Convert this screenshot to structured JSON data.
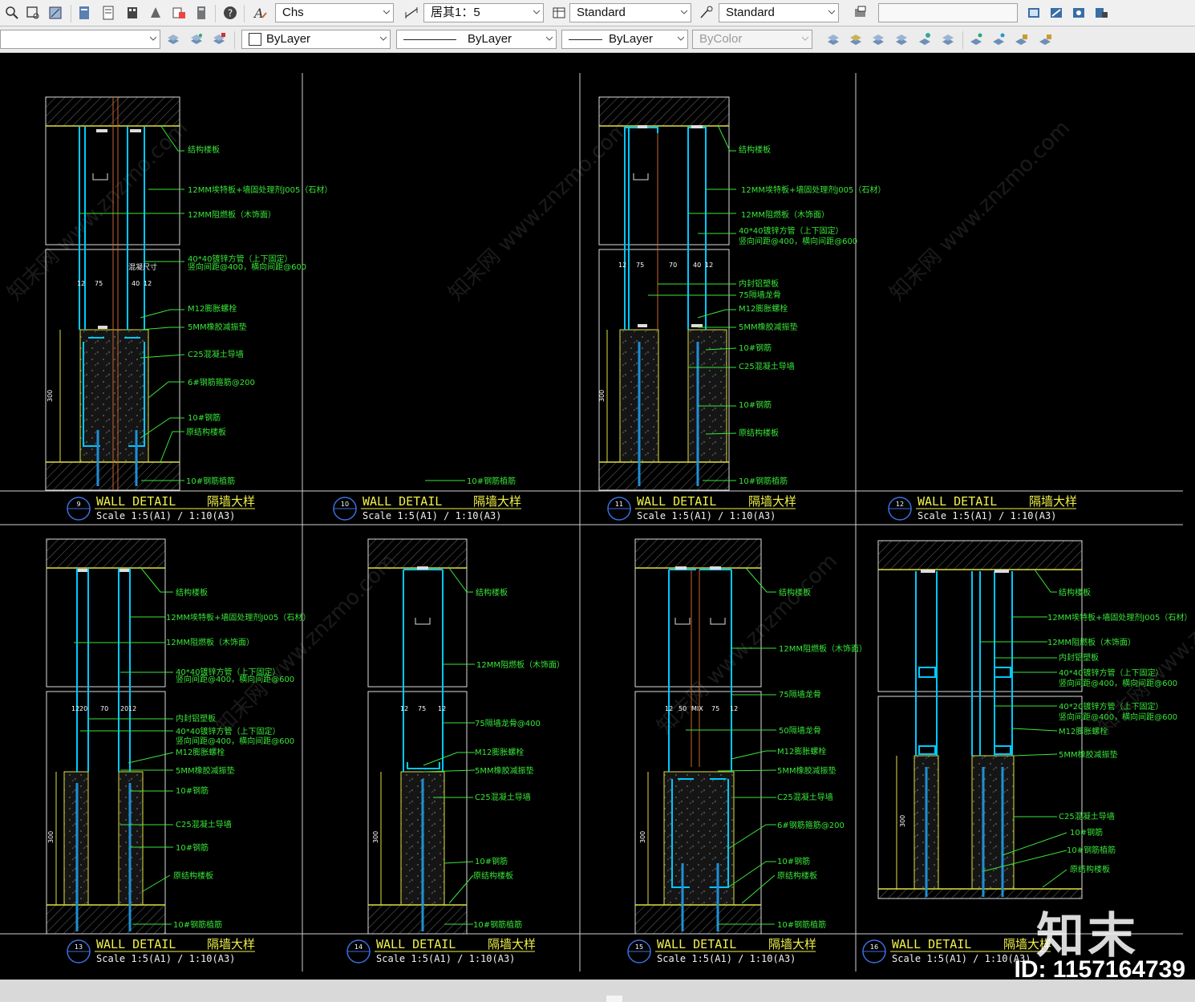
{
  "toolbar1": {
    "text_style": "Chs",
    "dim_scale": "居其1：5",
    "table_style": "Standard",
    "multileader_style": "Standard",
    "search_value": ""
  },
  "toolbar2": {
    "layer": "",
    "color": "ByLayer",
    "linetype": "ByLayer",
    "lineweight": "ByLayer",
    "plotstyle": "ByColor"
  },
  "watermark": {
    "text": "知末网 www.znzmo.com"
  },
  "logo": {
    "text": "知末",
    "id": "ID: 1157164739"
  },
  "details": [
    {
      "num": "9",
      "title": "WALL DETAIL",
      "cn": "隔墙大样",
      "scale": "Scale 1:5(A1) / 1:10(A3)"
    },
    {
      "num": "10",
      "title": "WALL DETAIL",
      "cn": "隔墙大样",
      "scale": "Scale 1:5(A1) / 1:10(A3)"
    },
    {
      "num": "11",
      "title": "WALL DETAIL",
      "cn": "隔墙大样",
      "scale": "Scale 1:5(A1) / 1:10(A3)"
    },
    {
      "num": "12",
      "title": "WALL DETAIL",
      "cn": "隔墙大样",
      "scale": "Scale 1:5(A1) / 1:10(A3)"
    },
    {
      "num": "13",
      "title": "WALL DETAIL",
      "cn": "隔墙大样",
      "scale": "Scale 1:5(A1) / 1:10(A3)"
    },
    {
      "num": "14",
      "title": "WALL DETAIL",
      "cn": "隔墙大样",
      "scale": "Scale 1:5(A1) / 1:10(A3)"
    },
    {
      "num": "15",
      "title": "WALL DETAIL",
      "cn": "隔墙大样",
      "scale": "Scale 1:5(A1) / 1:10(A3)"
    },
    {
      "num": "16",
      "title": "WALL DETAIL",
      "cn": "隔墙大样",
      "scale": "Scale 1:5(A1) / 1:10(A3)"
    }
  ],
  "labels": {
    "d9": [
      "结构楼板",
      "12MM埃特板+墙固处理剂J005（石材）",
      "12MM阻燃板（木饰面）",
      "40*40镀锌方管（上下固定）",
      "竖向间距@400，横向间距@600",
      "M12膨胀螺栓",
      "5MM橡胶减振垫",
      "C25混凝土导墙",
      "6#钢筋箍筋@200",
      "10#钢筋",
      "原结构楼板",
      "10#钢筋植筋"
    ],
    "d9_dims": [
      "12",
      "75",
      "40",
      "12",
      "300",
      "混凝尺寸"
    ],
    "d10": [
      "10#钢筋植筋"
    ],
    "d11": [
      "结构楼板",
      "12MM埃特板+墙固处理剂J005（石材）",
      "12MM阻燃板（木饰面）",
      "40*40镀锌方管（上下固定）",
      "竖向间距@400，横向间距@600",
      "内封铝塑板",
      "75隔墙龙骨",
      "M12膨胀螺栓",
      "5MM橡胶减振垫",
      "10#钢筋",
      "C25混凝土导墙",
      "10#钢筋",
      "原结构楼板",
      "10#钢筋植筋"
    ],
    "d11_dims": [
      "12",
      "75",
      "70",
      "40",
      "12",
      "300"
    ],
    "d13": [
      "结构楼板",
      "12MM埃特板+墙固处理剂J005（石材）",
      "12MM阻燃板（木饰面）",
      "40*40镀锌方管（上下固定）",
      "竖向间距@400，横向间距@600",
      "内封铝塑板",
      "40*40镀锌方管（上下固定）",
      "竖向间距@400，横向间距@600",
      "M12膨胀螺栓",
      "5MM橡胶减振垫",
      "10#钢筋",
      "C25混凝土导墙",
      "10#钢筋",
      "原结构楼板",
      "10#钢筋植筋"
    ],
    "d13_dims": [
      "12",
      "20",
      "70",
      "20",
      "12",
      "300"
    ],
    "d14": [
      "结构楼板",
      "12MM阻燃板（木饰面）",
      "75隔墙龙骨@400",
      "M12膨胀螺栓",
      "5MM橡胶减振垫",
      "C25混凝土导墙",
      "10#钢筋",
      "原结构楼板",
      "10#钢筋植筋"
    ],
    "d14_dims": [
      "12",
      "75",
      "12",
      "300"
    ],
    "d15": [
      "结构楼板",
      "12MM阻燃板（木饰面）",
      "75隔墙龙骨",
      "50隔墙龙骨",
      "M12膨胀螺栓",
      "5MM橡胶减振垫",
      "C25混凝土导墙",
      "6#钢筋箍筋@200",
      "10#钢筋",
      "原结构楼板",
      "10#钢筋植筋"
    ],
    "d15_dims": [
      "12",
      "50",
      "MIX",
      "75",
      "12",
      "300"
    ],
    "d16": [
      "结构楼板",
      "12MM埃特板+墙固处理剂J005（石材）",
      "12MM阻燃板（木饰面）",
      "内封铝塑板",
      "40*40镀锌方管（上下固定）",
      "竖向间距@400，横向间距@600",
      "40*20镀锌方管（上下固定）",
      "竖向间距@400，横向间距@600",
      "M12膨胀螺栓",
      "5MM橡胶减振垫",
      "C25混凝土导墙",
      "10#钢筋",
      "10#钢筋植筋",
      "原结构楼板"
    ],
    "d16_dims": [
      "300"
    ]
  },
  "colors": {
    "toolbar_bg": "#f0f0f0",
    "canvas_bg": "#000000",
    "label_green": "#39e639",
    "title_yellow": "#f2f24a",
    "steel_cyan": "#00c8ff",
    "rebar_blue": "#1f8fd6"
  }
}
